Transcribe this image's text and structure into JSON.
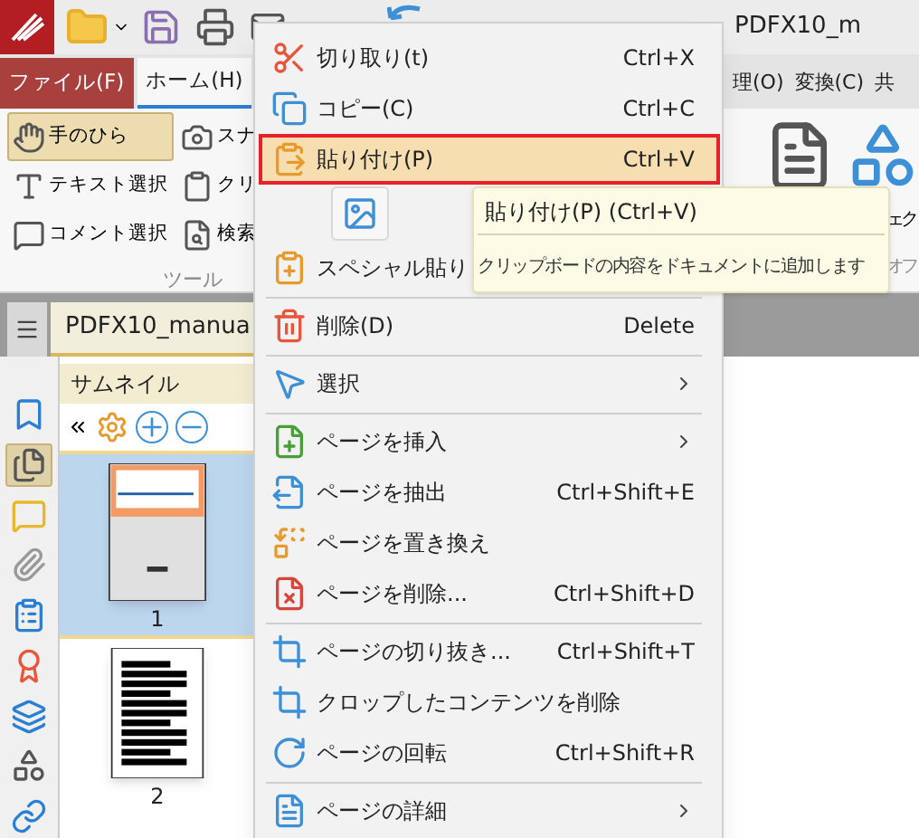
{
  "titlebar": {
    "title": "PDFX10_m"
  },
  "ribbon_tabs": [
    {
      "label": "ファイル(F)",
      "kind": "file",
      "selected": false
    },
    {
      "label": "ホーム(H)",
      "kind": "tab",
      "selected": true
    },
    {
      "label": "理(O)",
      "kind": "tab",
      "selected": false
    },
    {
      "label": "変換(C)",
      "kind": "tab",
      "selected": false
    },
    {
      "label": "共",
      "kind": "tab",
      "selected": false
    }
  ],
  "ribbon_tools": [
    {
      "label": "手のひら",
      "selected": true
    },
    {
      "label": "テキスト選択",
      "selected": false
    },
    {
      "label": "コメント選択",
      "selected": false
    },
    {
      "label": "スナ",
      "selected": false
    },
    {
      "label": "クリ",
      "selected": false
    },
    {
      "label": "検索",
      "selected": false
    }
  ],
  "ribbon_group_label": "ツール",
  "ribbon_right": {
    "button_label": "ェク",
    "group_label": "オフ"
  },
  "document_tab": {
    "label": "PDFX10_manua"
  },
  "thumbnails": {
    "title": "サムネイル",
    "pages": [
      {
        "number": "1",
        "selected": true
      },
      {
        "number": "2",
        "selected": false
      }
    ]
  },
  "sidebar_icons": [
    {
      "selected": false
    },
    {
      "selected": true
    },
    {
      "selected": false
    },
    {
      "selected": false
    },
    {
      "selected": false
    },
    {
      "selected": false
    },
    {
      "selected": false
    },
    {
      "selected": false
    },
    {
      "selected": false
    }
  ],
  "context_menu": [
    {
      "kind": "item",
      "label": "切り取り(t)",
      "shortcut": "Ctrl+X",
      "submenu": false,
      "highlighted": false
    },
    {
      "kind": "item",
      "label": "コピー(C)",
      "shortcut": "Ctrl+C",
      "submenu": false,
      "highlighted": false
    },
    {
      "kind": "item",
      "label": "貼り付け(P)",
      "shortcut": "Ctrl+V",
      "submenu": false,
      "highlighted": true
    },
    {
      "kind": "icon-row"
    },
    {
      "kind": "item",
      "label": "スペシャル貼り",
      "submenu": false,
      "highlighted": false
    },
    {
      "kind": "separator"
    },
    {
      "kind": "item",
      "label": "削除(D)",
      "shortcut": "Delete",
      "submenu": false,
      "highlighted": false
    },
    {
      "kind": "separator"
    },
    {
      "kind": "item",
      "label": "選択",
      "submenu": true,
      "highlighted": false
    },
    {
      "kind": "separator"
    },
    {
      "kind": "item",
      "label": "ページを挿入",
      "submenu": true,
      "highlighted": false
    },
    {
      "kind": "item",
      "label": "ページを抽出",
      "shortcut": "Ctrl+Shift+E",
      "submenu": false,
      "highlighted": false
    },
    {
      "kind": "item",
      "label": "ページを置き換え",
      "submenu": false,
      "highlighted": false
    },
    {
      "kind": "item",
      "label": "ページを削除...",
      "shortcut": "Ctrl+Shift+D",
      "submenu": false,
      "highlighted": false
    },
    {
      "kind": "separator"
    },
    {
      "kind": "item",
      "label": "ページの切り抜き...",
      "shortcut": "Ctrl+Shift+T",
      "submenu": false,
      "highlighted": false
    },
    {
      "kind": "item",
      "label": "クロップしたコンテンツを削除",
      "submenu": false,
      "highlighted": false
    },
    {
      "kind": "item",
      "label": "ページの回転",
      "shortcut": "Ctrl+Shift+R",
      "submenu": false,
      "highlighted": false
    },
    {
      "kind": "separator"
    },
    {
      "kind": "item",
      "label": "ページの詳細",
      "submenu": true,
      "highlighted": false
    }
  ],
  "tooltip": {
    "title": "貼り付け(P) (Ctrl+V)",
    "description": "クリップボードの内容をドキュメントに追加します"
  }
}
